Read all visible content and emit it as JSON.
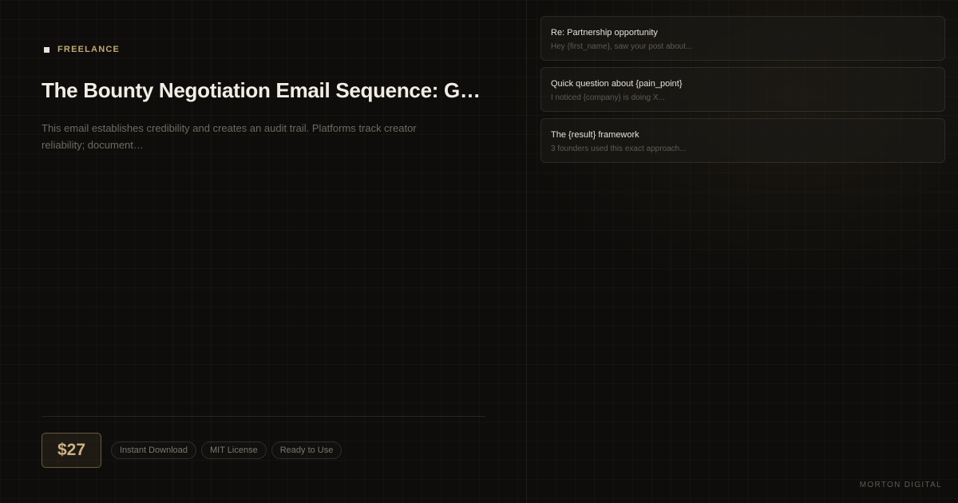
{
  "category": {
    "label": "FREELANCE"
  },
  "product": {
    "title": "The Bounty Negotiation Email Sequence: G…",
    "description": "This email establishes credibility and creates an audit trail. Platforms track creator reliability; document…",
    "price": "$27",
    "tags": [
      "Instant Download",
      "MIT License",
      "Ready to Use"
    ]
  },
  "emails": [
    {
      "subject": "Re: Partnership opportunity",
      "preview": "Hey {first_name}, saw your post about..."
    },
    {
      "subject": "Quick question about {pain_point}",
      "preview": "I noticed {company} is doing X..."
    },
    {
      "subject": "The {result} framework",
      "preview": "3 founders used this exact approach..."
    }
  ],
  "brand": "MORTON DIGITAL",
  "colors": {
    "background": "#0e0d0b",
    "accent": "#c2a877",
    "title": "#f1ede4",
    "muted": "#6f6a61"
  }
}
